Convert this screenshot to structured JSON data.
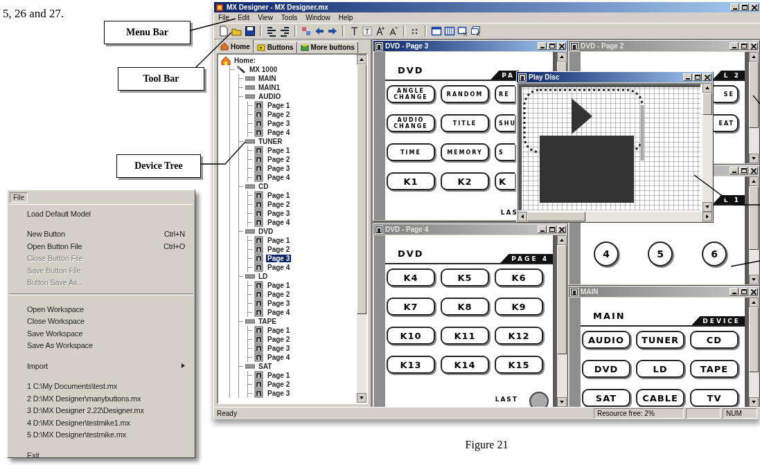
{
  "page_text": "5, 26 and 27.",
  "callouts": [
    {
      "label": "Menu Bar"
    },
    {
      "label": "Tool Bar"
    },
    {
      "label": "Device Tree"
    }
  ],
  "file_menu": {
    "title": "File",
    "items": [
      {
        "kind": "item",
        "label": "Load Default Model",
        "disabled": false
      },
      {
        "kind": "gap"
      },
      {
        "kind": "item",
        "label": "New Button",
        "shortcut": "Ctrl+N",
        "disabled": false
      },
      {
        "kind": "item",
        "label": "Open Button File",
        "shortcut": "Ctrl+O",
        "disabled": false
      },
      {
        "kind": "item",
        "label": "Close Button File",
        "disabled": true
      },
      {
        "kind": "item",
        "label": "Save Button File",
        "disabled": true
      },
      {
        "kind": "item",
        "label": "Button Save As...",
        "disabled": true
      },
      {
        "kind": "separator"
      },
      {
        "kind": "item",
        "label": "Open Workspace",
        "disabled": false
      },
      {
        "kind": "item",
        "label": "Close Workspace",
        "disabled": false
      },
      {
        "kind": "item",
        "label": "Save Workspace",
        "disabled": false
      },
      {
        "kind": "item",
        "label": "Save As Workspace",
        "disabled": false
      },
      {
        "kind": "gap"
      },
      {
        "kind": "submenu",
        "label": "Import",
        "disabled": false
      },
      {
        "kind": "gap"
      },
      {
        "kind": "item",
        "label": "1 C:\\My Documents\\test.mx",
        "disabled": false
      },
      {
        "kind": "item",
        "label": "2 D:\\MX Designer\\manybuttons.mx",
        "disabled": false
      },
      {
        "kind": "item",
        "label": "3 D:\\MX Designer 2.22\\Designer.mx",
        "disabled": false
      },
      {
        "kind": "item",
        "label": "4 D:\\MX Designer\\testmike1.mx",
        "disabled": false
      },
      {
        "kind": "item",
        "label": "5 D:\\MX Designer\\testmike.mx",
        "disabled": false
      },
      {
        "kind": "gap"
      },
      {
        "kind": "item",
        "label": "Exit",
        "disabled": false
      }
    ]
  },
  "app": {
    "title": "MX Designer - MX Designer.mx",
    "menu": [
      "File",
      "Edit",
      "View",
      "Tools",
      "Window",
      "Help"
    ],
    "panel_tabs": [
      {
        "label": "Home",
        "selected": true
      },
      {
        "label": "Buttons",
        "selected": false
      },
      {
        "label": "More buttons",
        "selected": false
      }
    ],
    "tree": {
      "kind": "home",
      "label": "Home:",
      "selected": false,
      "children": [
        {
          "kind": "remote",
          "label": "MX 1000",
          "selected": false,
          "children": [
            {
              "kind": "device",
              "label": "MAIN",
              "selected": false
            },
            {
              "kind": "device",
              "label": "MAIN1",
              "selected": false
            },
            {
              "kind": "device",
              "label": "AUDIO",
              "selected": false,
              "children": [
                {
                  "kind": "page",
                  "label": "Page 1",
                  "selected": false
                },
                {
                  "kind": "page",
                  "label": "Page 2",
                  "selected": false
                },
                {
                  "kind": "page",
                  "label": "Page 3",
                  "selected": false
                },
                {
                  "kind": "page",
                  "label": "Page 4",
                  "selected": false
                }
              ]
            },
            {
              "kind": "device",
              "label": "TUNER",
              "selected": false,
              "children": [
                {
                  "kind": "page",
                  "label": "Page 1",
                  "selected": false
                },
                {
                  "kind": "page",
                  "label": "Page 2",
                  "selected": false
                },
                {
                  "kind": "page",
                  "label": "Page 3",
                  "selected": false
                },
                {
                  "kind": "page",
                  "label": "Page 4",
                  "selected": false
                }
              ]
            },
            {
              "kind": "device",
              "label": "CD",
              "selected": false,
              "children": [
                {
                  "kind": "page",
                  "label": "Page 1",
                  "selected": false
                },
                {
                  "kind": "page",
                  "label": "Page 2",
                  "selected": false
                },
                {
                  "kind": "page",
                  "label": "Page 3",
                  "selected": false
                },
                {
                  "kind": "page",
                  "label": "Page 4",
                  "selected": false
                }
              ]
            },
            {
              "kind": "device",
              "label": "DVD",
              "selected": false,
              "children": [
                {
                  "kind": "page",
                  "label": "Page 1",
                  "selected": false
                },
                {
                  "kind": "page",
                  "label": "Page 2",
                  "selected": false
                },
                {
                  "kind": "page",
                  "label": "Page 3",
                  "selected": true
                },
                {
                  "kind": "page",
                  "label": "Page 4",
                  "selected": false
                }
              ]
            },
            {
              "kind": "device",
              "label": "LD",
              "selected": false,
              "children": [
                {
                  "kind": "page",
                  "label": "Page 1",
                  "selected": false
                },
                {
                  "kind": "page",
                  "label": "Page 2",
                  "selected": false
                },
                {
                  "kind": "page",
                  "label": "Page 3",
                  "selected": false
                },
                {
                  "kind": "page",
                  "label": "Page 4",
                  "selected": false
                }
              ]
            },
            {
              "kind": "device",
              "label": "TAPE",
              "selected": false,
              "children": [
                {
                  "kind": "page",
                  "label": "Page 1",
                  "selected": false
                },
                {
                  "kind": "page",
                  "label": "Page 2",
                  "selected": false
                },
                {
                  "kind": "page",
                  "label": "Page 3",
                  "selected": false
                },
                {
                  "kind": "page",
                  "label": "Page 4",
                  "selected": false
                }
              ]
            },
            {
              "kind": "device",
              "label": "SAT",
              "selected": false,
              "children": [
                {
                  "kind": "page",
                  "label": "Page 1",
                  "selected": false
                },
                {
                  "kind": "page",
                  "label": "Page 2",
                  "selected": false
                },
                {
                  "kind": "page",
                  "label": "Page 3",
                  "selected": false
                }
              ]
            }
          ]
        }
      ]
    },
    "windows": [
      {
        "kind": "remote",
        "title": "DVD - Page 3",
        "active": true,
        "header": "DVD",
        "tab": "PA",
        "tab_cut_right": true,
        "footer": "LAS",
        "footer_knob": false,
        "keys": [
          {
            "kind": "text",
            "label": "ANGLE CHANGE"
          },
          {
            "kind": "text",
            "label": "RANDOM"
          },
          {
            "kind": "text",
            "label": "RE",
            "cut_right": true
          },
          {
            "kind": "text",
            "label": "AUDIO CHANGE"
          },
          {
            "kind": "text",
            "label": "TITLE"
          },
          {
            "kind": "text",
            "label": "SHU",
            "cut_right": true
          },
          {
            "kind": "text",
            "label": "TIME"
          },
          {
            "kind": "text",
            "label": "MEMORY"
          },
          {
            "kind": "text",
            "label": "S",
            "cut_right": true
          },
          {
            "kind": "big",
            "label": "K1"
          },
          {
            "kind": "big",
            "label": "K2"
          },
          {
            "kind": "big",
            "label": "K",
            "cut_right": true
          }
        ]
      },
      {
        "kind": "remote",
        "title": "DVD - Page 2",
        "active": false,
        "tab": "L 2",
        "keys": [
          {
            "kind": "text",
            "label": "SE",
            "cut_left": true
          },
          {
            "kind": "text",
            "label": "EAT",
            "cut_left": true
          }
        ]
      },
      {
        "kind": "numpad",
        "active": false,
        "tab": "L 1",
        "keys": [
          {
            "kind": "round",
            "label": "4"
          },
          {
            "kind": "round",
            "label": "5"
          },
          {
            "kind": "round",
            "label": "6"
          }
        ]
      },
      {
        "kind": "remote",
        "title": "DVD - Page 4",
        "active": false,
        "header": "DVD",
        "tab": "PAGE 4",
        "footer": "LAST",
        "footer_knob": true,
        "keys": [
          {
            "kind": "big",
            "label": "K4"
          },
          {
            "kind": "big",
            "label": "K5"
          },
          {
            "kind": "big",
            "label": "K6"
          },
          {
            "kind": "big",
            "label": "K7"
          },
          {
            "kind": "big",
            "label": "K8"
          },
          {
            "kind": "big",
            "label": "K9"
          },
          {
            "kind": "big",
            "label": "K10"
          },
          {
            "kind": "big",
            "label": "K11"
          },
          {
            "kind": "big",
            "label": "K12"
          },
          {
            "kind": "big",
            "label": "K13"
          },
          {
            "kind": "big",
            "label": "K14"
          },
          {
            "kind": "big",
            "label": "K15"
          }
        ]
      },
      {
        "kind": "remote",
        "title": "MAIN",
        "active": false,
        "header": "MAIN",
        "tab": "DEVICE",
        "keys": [
          {
            "kind": "big",
            "label": "AUDIO"
          },
          {
            "kind": "big",
            "label": "TUNER"
          },
          {
            "kind": "big",
            "label": "CD"
          },
          {
            "kind": "big",
            "label": "DVD"
          },
          {
            "kind": "big",
            "label": "LD"
          },
          {
            "kind": "big",
            "label": "TAPE"
          },
          {
            "kind": "big",
            "label": "SAT"
          },
          {
            "kind": "big",
            "label": "CABLE"
          },
          {
            "kind": "big",
            "label": "TV"
          }
        ]
      },
      {
        "kind": "pixel",
        "title": "Play Disc",
        "active": true
      }
    ],
    "status_bar": {
      "message": "Ready",
      "resources": "Resource free: 2%",
      "indicator": "NUM"
    }
  },
  "caption": "Figure 21"
}
